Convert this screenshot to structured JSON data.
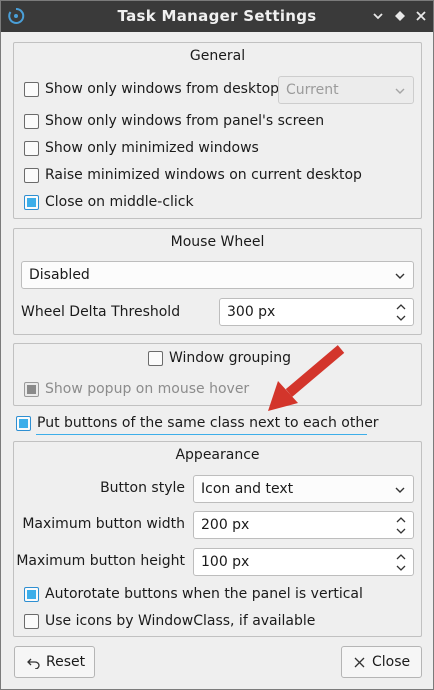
{
  "window": {
    "title": "Task Manager Settings"
  },
  "titlebar": {
    "minimize": "▾",
    "restore": "◆",
    "close": "✕"
  },
  "general": {
    "title": "General",
    "show_only_desktop": {
      "label": "Show only windows from desktop",
      "checked": false
    },
    "desktop_combo": {
      "value": "Current",
      "disabled": true
    },
    "show_only_panel_screen": {
      "label": "Show only windows from panel's screen",
      "checked": false
    },
    "show_only_minimized": {
      "label": "Show only minimized windows",
      "checked": false
    },
    "raise_minimized": {
      "label": "Raise minimized windows on current desktop",
      "checked": false
    },
    "close_middle_click": {
      "label": "Close on middle-click",
      "checked": true
    }
  },
  "mouse_wheel": {
    "title": "Mouse Wheel",
    "mode": "Disabled",
    "threshold_label": "Wheel Delta Threshold",
    "threshold_value": "300 px"
  },
  "grouping": {
    "window_grouping": {
      "label": "Window grouping",
      "checked": false
    },
    "show_popup": {
      "label": "Show popup on mouse hover",
      "checked": true,
      "disabled": true
    }
  },
  "put_buttons": {
    "label": "Put buttons of the same class next to each other",
    "checked": true
  },
  "appearance": {
    "title": "Appearance",
    "button_style_label": "Button style",
    "button_style_value": "Icon and text",
    "max_width_label": "Maximum button width",
    "max_width_value": "200 px",
    "max_height_label": "Maximum button height",
    "max_height_value": "100 px",
    "autorotate": {
      "label": "Autorotate buttons when the panel is vertical",
      "checked": true
    },
    "use_icons": {
      "label": "Use icons by WindowClass, if available",
      "checked": false
    }
  },
  "footer": {
    "reset_label": "Reset",
    "close_label": "Close"
  },
  "colors": {
    "accent": "#3daee9",
    "titlebar": "#3a3a3a",
    "annotation_arrow": "#d3352b"
  }
}
